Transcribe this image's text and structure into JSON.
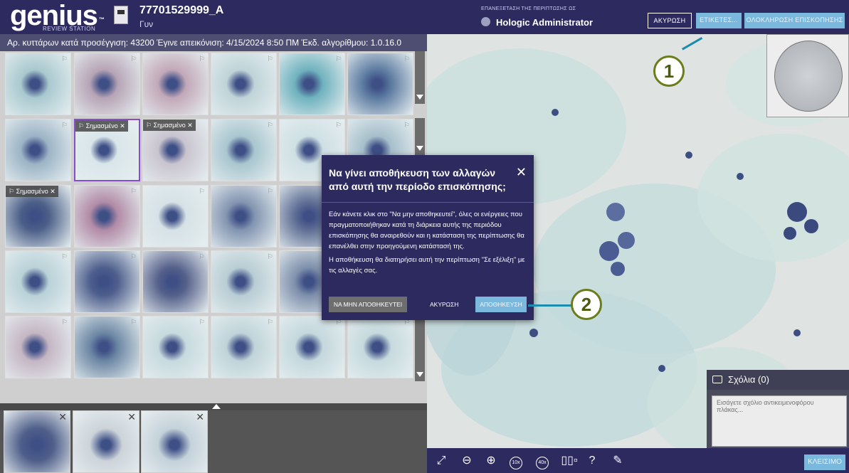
{
  "header": {
    "logo": "genius",
    "logo_tm": "™",
    "logo_sub": "REVIEW STATION",
    "case_id": "77701529999_A",
    "case_type": "Γυν",
    "review_label": "ΕΠΑΝΕΞΕΤΑΣΗ ΤΗΣ ΠΕΡΙΠΤΩΣΗΣ ΩΣ",
    "user": "Hologic Administrator",
    "cancel_label": "ΑΚΥΡΩΣΗ",
    "labels_label": "ΕΤΙΚΕΤΕΣ...",
    "complete_label": "ΟΛΟΚΛΗΡΩΣΗ ΕΠΙΣΚΟΠΗΣΗΣ"
  },
  "info_bar": "Αρ. κυττάρων κατά προσέγγιση: 43200  Έγινε απεικόνιση: 4/15/2024 8:50 ΠΜ  Έκδ. αλγορίθμου: 1.0.16.0",
  "grid": {
    "marked_label": "Σημασμένο",
    "rows": [
      [
        {
          "c": "#a9c9cf",
          "flag": true
        },
        {
          "c": "#b7a4b6",
          "flag": true
        },
        {
          "c": "#c2a8b8",
          "flag": true
        },
        {
          "c": "#bfd4d8",
          "flag": true
        },
        {
          "c": "#6fb2be",
          "flag": true
        },
        {
          "c": "#5b7aa0",
          "flag": true
        }
      ],
      [
        {
          "c": "#9cb4c6",
          "flag": true
        },
        {
          "c": "#d9e6ea",
          "marked": true,
          "selected": true
        },
        {
          "c": "#c9c4cf",
          "marked": true
        },
        {
          "c": "#a9c6cf",
          "flag": true
        },
        {
          "c": "#cfe0e4",
          "flag": true
        },
        {
          "c": "#a6bfcb",
          "flag": true
        }
      ],
      [
        {
          "c": "#4b5f88",
          "marked": true
        },
        {
          "c": "#b28ba7",
          "flag": true
        },
        {
          "c": "#d6e2e6",
          "flag": true
        },
        {
          "c": "#8294b0",
          "flag": true
        },
        {
          "c": "#5f6f95",
          "flag": true
        }
      ],
      [
        {
          "c": "#b9d2d8",
          "flag": true
        },
        {
          "c": "#4e5f8d",
          "flag": true
        },
        {
          "c": "#55608a",
          "flag": true
        },
        {
          "c": "#b8cdd4",
          "flag": true
        },
        {
          "c": "#7f90ac",
          "flag": true
        }
      ],
      [
        {
          "c": "#c5b6c4",
          "flag": true
        },
        {
          "c": "#6c87a4",
          "flag": true
        },
        {
          "c": "#c7dade",
          "flag": true
        },
        {
          "c": "#bfd4d9",
          "flag": true
        },
        {
          "c": "#c4d8dd",
          "flag": true
        },
        {
          "c": "#c6dade",
          "flag": true
        }
      ]
    ]
  },
  "tray": [
    {
      "c": "#4f5f8a"
    },
    {
      "c": "#ccd4da"
    },
    {
      "c": "#c4d2da"
    }
  ],
  "viewer": {
    "comments_title": "Σχόλια (0)",
    "comments_placeholder": "Εισάγετε σχόλιο αντικειμενοφόρου πλάκας...",
    "close_label": "ΚΛΕΙΣΙΜΟ",
    "tools": [
      {
        "name": "fullscreen-icon",
        "glyph": "⤢"
      },
      {
        "name": "zoom-out-icon",
        "glyph": "⊖"
      },
      {
        "name": "zoom-in-icon",
        "glyph": "⊕"
      },
      {
        "name": "zoom-10x-icon",
        "circle": "10x"
      },
      {
        "name": "zoom-40x-icon",
        "circle": "40x"
      },
      {
        "name": "focus-bars-icon",
        "glyph": "▯▯▫"
      },
      {
        "name": "help-icon",
        "glyph": "?"
      },
      {
        "name": "pen-icon",
        "glyph": "✎"
      }
    ]
  },
  "dialog": {
    "title": "Να γίνει αποθήκευση των αλλαγών από αυτή την περίοδο επισκόπησης;",
    "para1": "Εάν κάνετε κλικ στο \"Να μην αποθηκευτεί\", όλες οι ενέργειες που πραγματοποιήθηκαν κατά τη διάρκεια αυτής της περιόδου επισκόπησης θα αναιρεθούν και η κατάσταση της περίπτωσης θα επανέλθει στην προηγούμενη κατάστασή της.",
    "para2": "Η αποθήκευση θα διατηρήσει αυτή την περίπτωση \"Σε εξέλιξη\" με τις αλλαγές σας.",
    "no_save_label": "ΝΑ ΜΗΝ ΑΠΟΘΗΚΕΥΤΕΙ",
    "cancel_label": "ΑΚΥΡΩΣΗ",
    "save_label": "ΑΠΟΘΗΚΕΥΣΗ"
  },
  "callouts": {
    "one": "1",
    "two": "2"
  },
  "colors": {
    "navy": "#2c2a5e",
    "accent": "#7ab8de",
    "callout_green": "#6a7d1a",
    "callout_line": "#1b8cb0",
    "selected": "#8a4ccf"
  }
}
